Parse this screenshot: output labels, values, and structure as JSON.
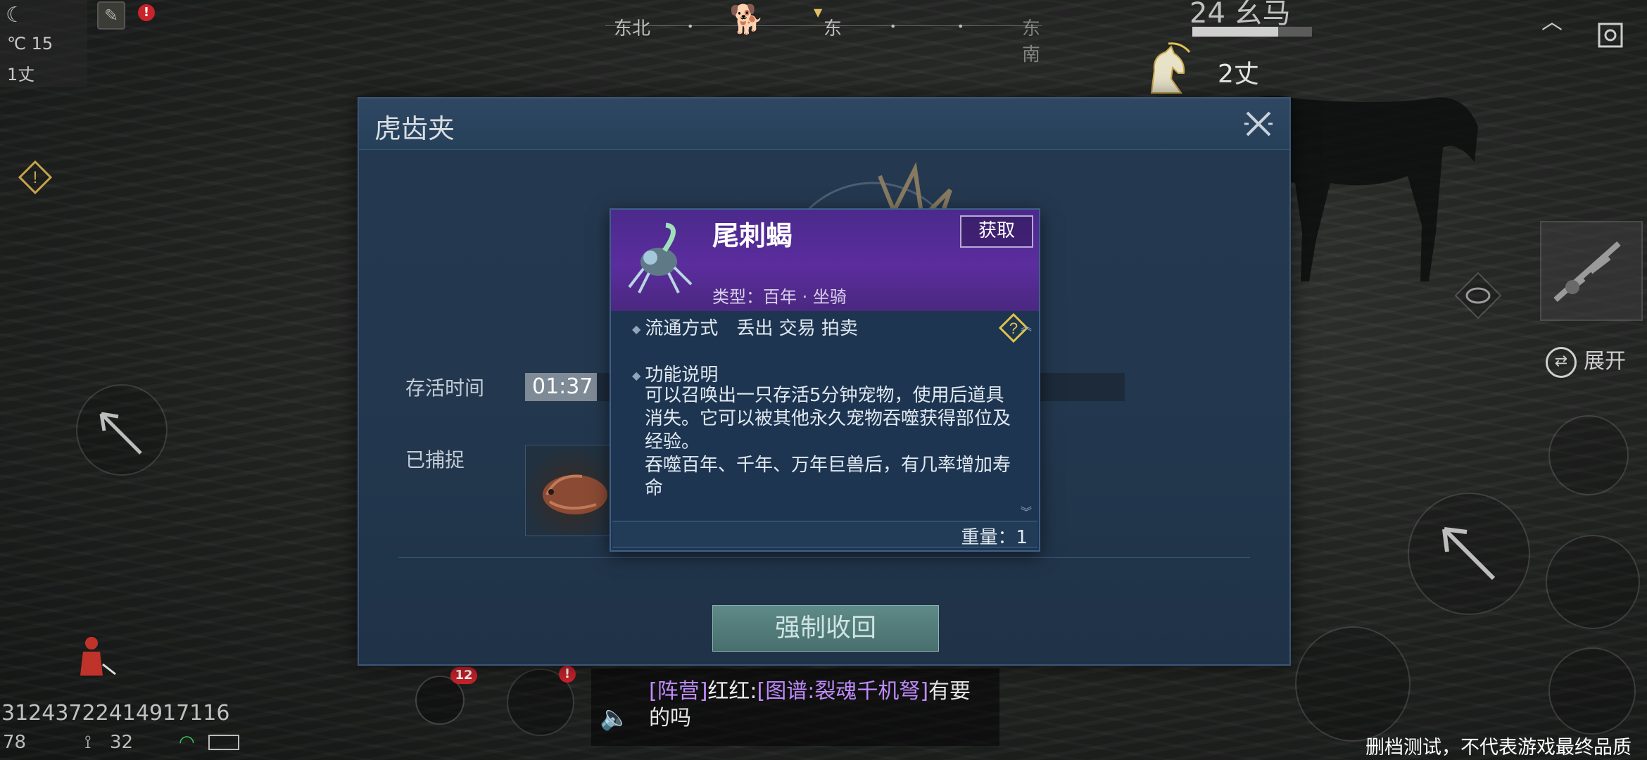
{
  "hud": {
    "temperature": "℃ 15",
    "altitude": "1丈",
    "compass": {
      "items": [
        "东北",
        "东",
        "东南"
      ]
    },
    "target_title": "24 幺马",
    "target_hp": 0.72,
    "distance": "2丈",
    "expand_label": "展开",
    "uid": "31243722414917116",
    "status_left": "78",
    "status_signal": "32",
    "pet_badge": "12",
    "alert_badge": "!"
  },
  "chat": {
    "tag": "[阵营]",
    "sender": "红红",
    "item_link": "[图谱:裂魂千机弩]",
    "message": "有要的吗"
  },
  "watermark": "删档测试，不代表游戏最终品质",
  "dialog": {
    "title": "虎齿夹",
    "close_icon": "close-icon",
    "survival_label": "存活时间",
    "survival_time": "01:37",
    "survival_fraction": 0.12,
    "captured_label": "已捕捉",
    "recall_button": "强制收回"
  },
  "tooltip": {
    "name": "尾刺蝎",
    "type": "类型：百年 · 坐骑",
    "acquire": "获取",
    "circulation_label": "流通方式",
    "circulation_value": "丢出 交易 拍卖",
    "function_label": "功能说明",
    "function_text": "可以召唤出一只存活5分钟宠物，使用后道具消失。它可以被其他永久宠物吞噬获得部位及经验。",
    "function_text2": "吞噬百年、千年、万年巨兽后，有几率增加寿命",
    "weight": "重量：1"
  },
  "colors": {
    "tooltip_header": "#5b2d9e",
    "dialog_bg": "#24384f",
    "recall_button": "#5e8a88",
    "alert": "#c9232b"
  }
}
